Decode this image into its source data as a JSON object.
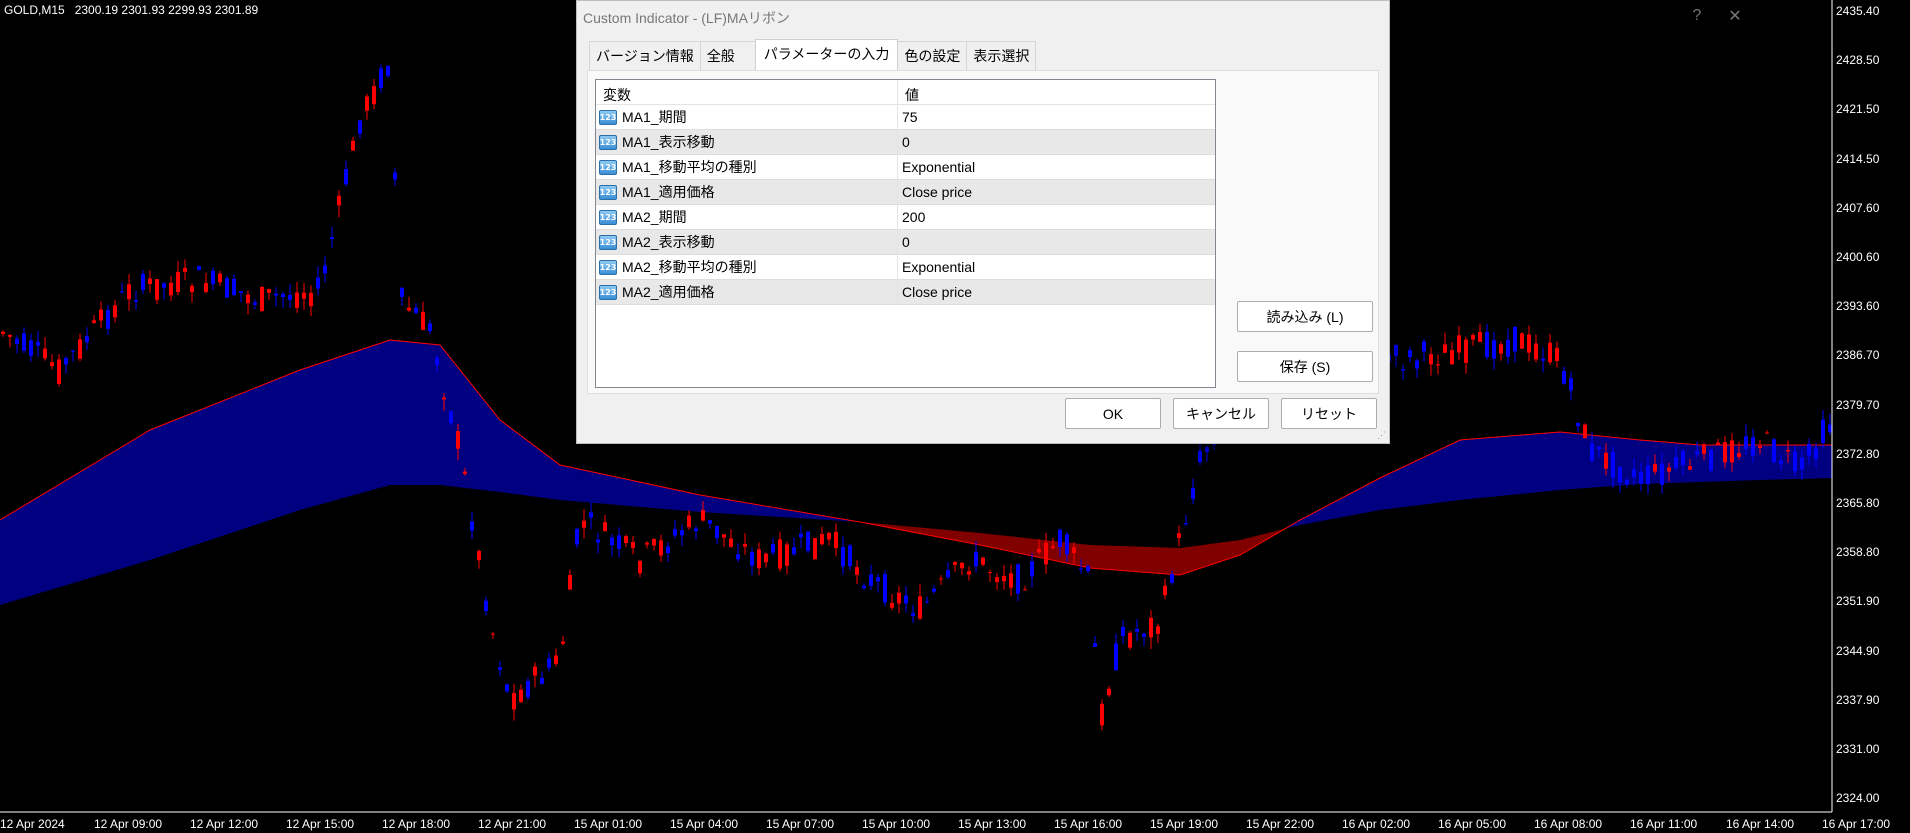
{
  "chart_header": {
    "symbol": "GOLD,M15",
    "ohlc": "2300.19 2301.93 2299.93 2301.89"
  },
  "price_axis": [
    "2435.40",
    "2428.50",
    "2421.50",
    "2414.50",
    "2407.60",
    "2400.60",
    "2393.60",
    "2386.70",
    "2379.70",
    "2372.80",
    "2365.80",
    "2358.80",
    "2351.90",
    "2344.90",
    "2337.90",
    "2331.00",
    "2324.00"
  ],
  "time_axis": [
    "12 Apr 2024",
    "12 Apr 09:00",
    "12 Apr 12:00",
    "12 Apr 15:00",
    "12 Apr 18:00",
    "12 Apr 21:00",
    "15 Apr 01:00",
    "15 Apr 04:00",
    "15 Apr 07:00",
    "15 Apr 10:00",
    "15 Apr 13:00",
    "15 Apr 16:00",
    "15 Apr 19:00",
    "15 Apr 22:00",
    "16 Apr 02:00",
    "16 Apr 05:00",
    "16 Apr 08:00",
    "16 Apr 11:00",
    "16 Apr 14:00",
    "16 Apr 17:00"
  ],
  "colors": {
    "bull": "#0000ff",
    "bear": "#ff0000",
    "ribbon_up": "#000080",
    "ribbon_down": "#800000",
    "ma_line": "#ff0000"
  },
  "dialog": {
    "title": "Custom Indicator - (LF)MAリボン",
    "help_icon": "?",
    "close_icon": "✕",
    "tabs": [
      "バージョン情報",
      "全般",
      "パラメーターの入力",
      "色の設定",
      "表示選択"
    ],
    "active_tab": 2,
    "grid_headers": {
      "variable": "変数",
      "value": "値"
    },
    "params": [
      {
        "name": "MA1_期間",
        "value": "75"
      },
      {
        "name": "MA1_表示移動",
        "value": "0"
      },
      {
        "name": "MA1_移動平均の種別",
        "value": "Exponential"
      },
      {
        "name": "MA1_適用価格",
        "value": "Close price"
      },
      {
        "name": "MA2_期間",
        "value": "200"
      },
      {
        "name": "MA2_表示移動",
        "value": "0"
      },
      {
        "name": "MA2_移動平均の種別",
        "value": "Exponential"
      },
      {
        "name": "MA2_適用価格",
        "value": "Close price"
      }
    ],
    "param_icon": "123",
    "load_button": "読み込み (L)",
    "save_button": "保存 (S)",
    "ok_button": "OK",
    "cancel_button": "キャンセル",
    "reset_button": "リセット"
  }
}
